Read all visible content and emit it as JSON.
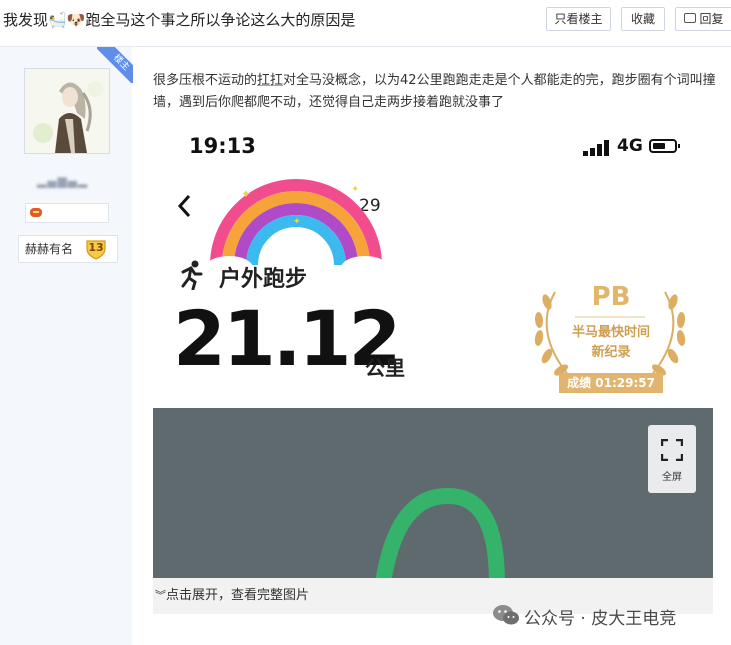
{
  "header": {
    "title": "我发现🛀🐶跑全马这个事之所以争论这么大的原因是",
    "buttons": {
      "only_op": "只看楼主",
      "favorite": "收藏",
      "reply": "回复"
    }
  },
  "user": {
    "op_badge": "楼主",
    "rank_name": "赫赫有名",
    "rank_level": "13"
  },
  "post": {
    "text_before": "很多压根不运动的",
    "text_highlight": "扛扛",
    "text_after": "对全马没概念，以为42公里跑跑走走是个人都能走的完，跑步圈有个词叫撞墙，遇到后你爬都爬不动，还觉得自己走两步接着跑就没事了",
    "image": {
      "status_time": "19:13",
      "network": "4G",
      "date_partial": "29",
      "activity": "户外跑步",
      "distance": "21.12",
      "distance_unit": "公里",
      "pb_title": "PB",
      "pb_line1": "半马最快时间",
      "pb_line2": "新纪录",
      "pb_score": "成绩 01:29:57",
      "fullscreen_label": "全屏",
      "expand_text": "点击展开，查看完整图片"
    }
  },
  "watermark": {
    "text": "公众号 · 皮大王电竞"
  }
}
